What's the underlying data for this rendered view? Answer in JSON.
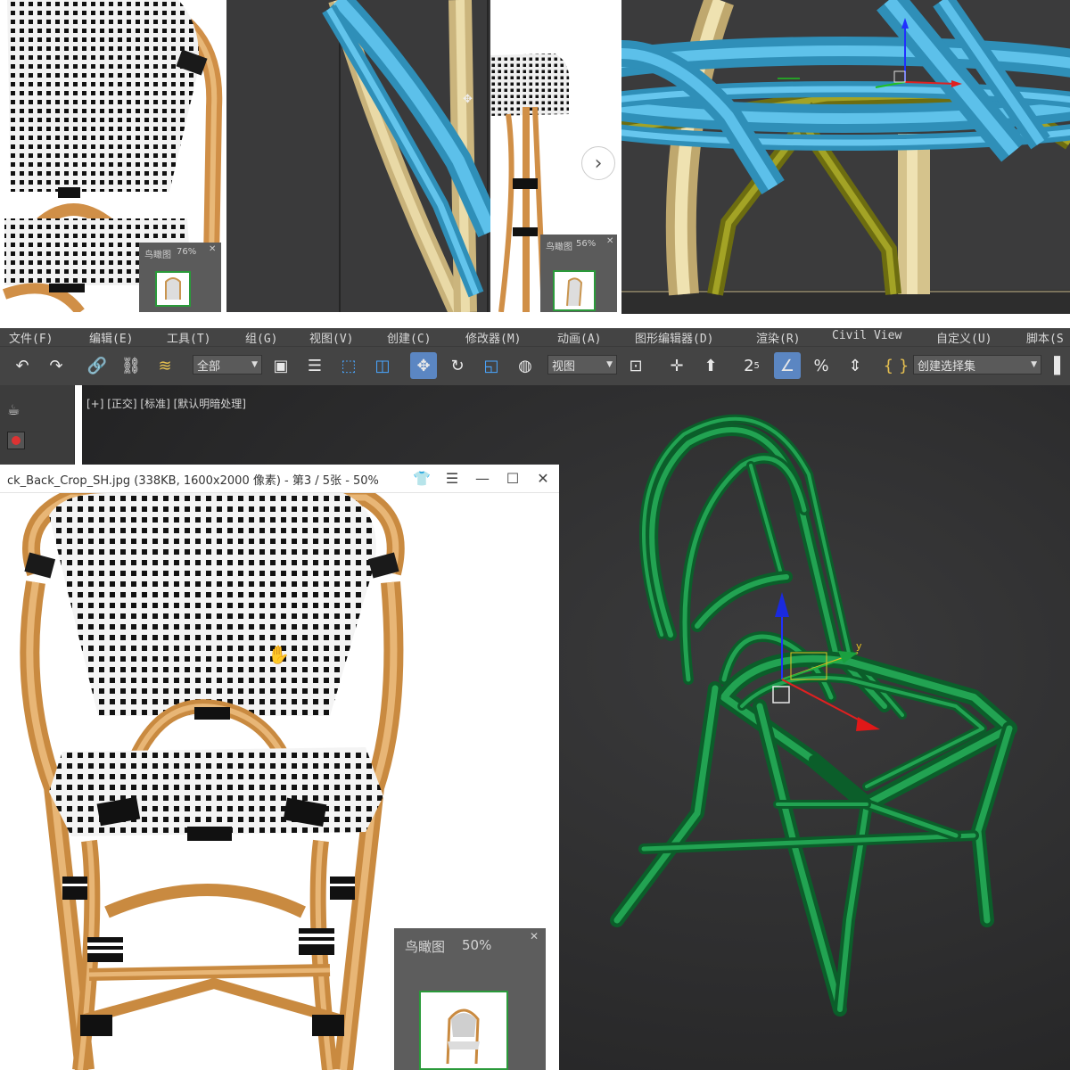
{
  "menu": {
    "file": "文件(F)",
    "edit": "编辑(E)",
    "tools": "工具(T)",
    "group": "组(G)",
    "views": "视图(V)",
    "create": "创建(C)",
    "modifiers": "修改器(M)",
    "animation": "动画(A)",
    "graph_editors": "图形编辑器(D)",
    "rendering": "渲染(R)",
    "civil_view": "Civil View",
    "customize": "自定义(U)",
    "scripting": "脚本(S"
  },
  "toolbar": {
    "selection_filter": "全部",
    "reference_coord": "视图",
    "named_selection": "创建选择集",
    "snap_label": "2",
    "snap_sub": "5"
  },
  "viewport": {
    "label": "[+] [正交] [标准] [默认明暗处理]"
  },
  "image_viewer": {
    "title": "ck_Back_Crop_SH.jpg (338KB, 1600x2000 像素) - 第3 / 5张 - 50%"
  },
  "navigator_main": {
    "title": "鸟瞰图",
    "zoom": "50%"
  },
  "navigator_top_left": {
    "title": "鸟瞰图",
    "zoom": "76%"
  },
  "navigator_top_mid": {
    "title": "鸟瞰图",
    "zoom": "56%"
  },
  "icons": {
    "next": "chevron-right-icon",
    "close": "close-icon"
  },
  "colors": {
    "max_bg": "#444444",
    "viewport_bg": "#2f2f30",
    "model_green": "#1e8a45",
    "model_blue": "#3aa6d4",
    "model_tan": "#d9c58a",
    "model_olive": "#8a8a1e",
    "rattan": "#d79a50"
  }
}
